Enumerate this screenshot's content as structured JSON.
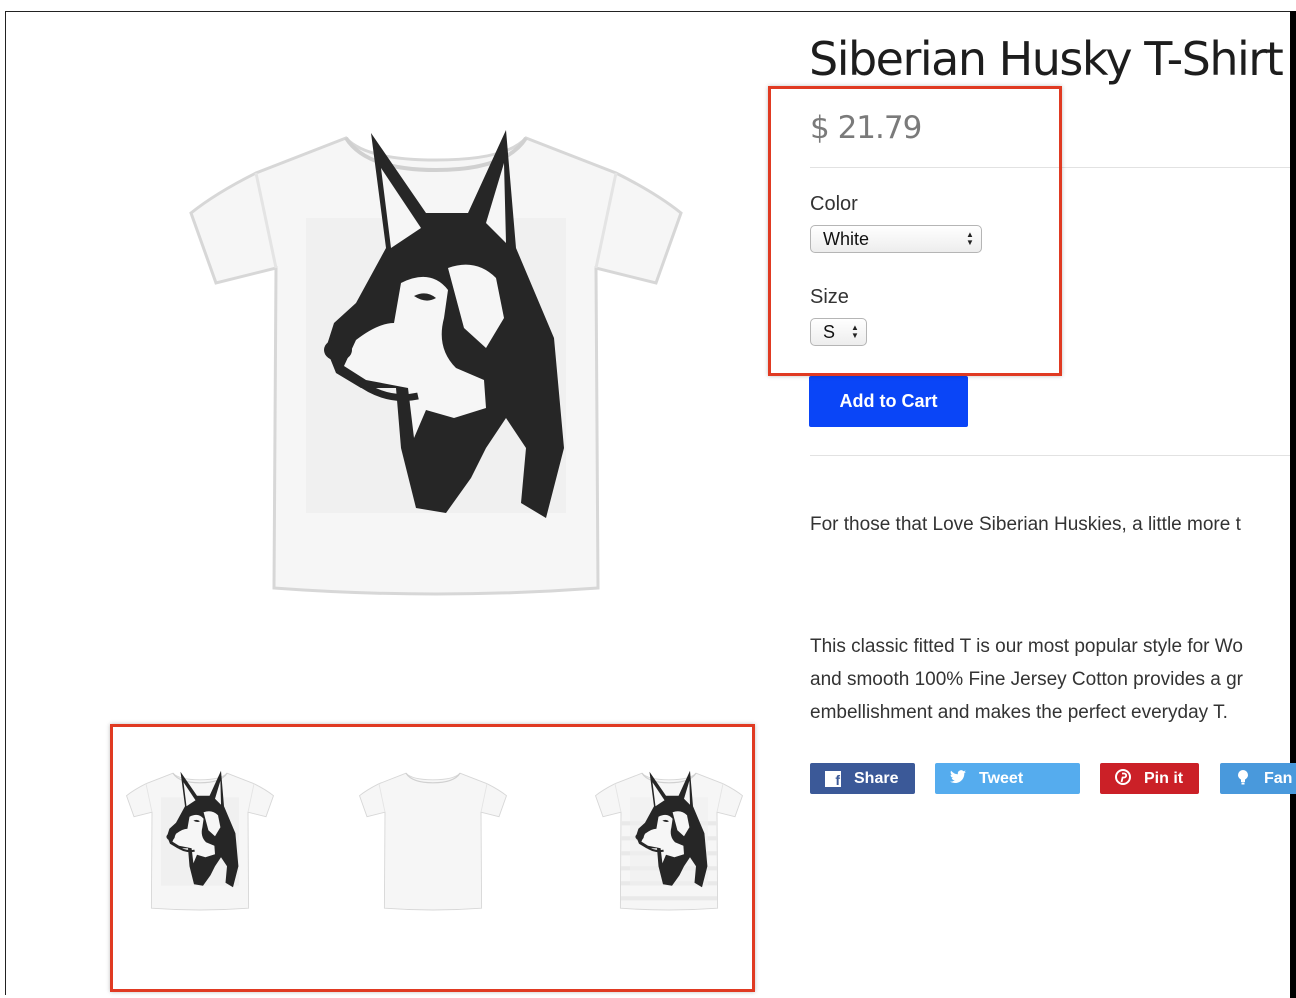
{
  "product": {
    "title": "Siberian Husky T-Shirt",
    "price": "$ 21.79"
  },
  "options": {
    "color_label": "Color",
    "color_value": "White",
    "size_label": "Size",
    "size_value": "S"
  },
  "cart": {
    "add_label": "Add to Cart"
  },
  "description": {
    "intro": "For those that Love Siberian Huskies, a little more t",
    "body_line1": "This classic fitted T is our most popular style for Wo",
    "body_line2": "and smooth 100% Fine Jersey Cotton provides a gr",
    "body_line3": "embellishment and makes the perfect everyday T."
  },
  "share": {
    "facebook_label": "Share",
    "twitter_label": "Tweet",
    "pinterest_label": "Pin it",
    "fancy_label": "Fan"
  },
  "colors": {
    "add_button": "#0a45f7",
    "facebook": "#3b5998",
    "twitter": "#55acee",
    "pinterest": "#cb2027",
    "fancy": "#4999dc",
    "annotation": "#e03a22"
  },
  "icons": {
    "facebook": "facebook-icon",
    "twitter": "twitter-icon",
    "pinterest": "pinterest-icon",
    "fancy": "fancy-icon"
  }
}
